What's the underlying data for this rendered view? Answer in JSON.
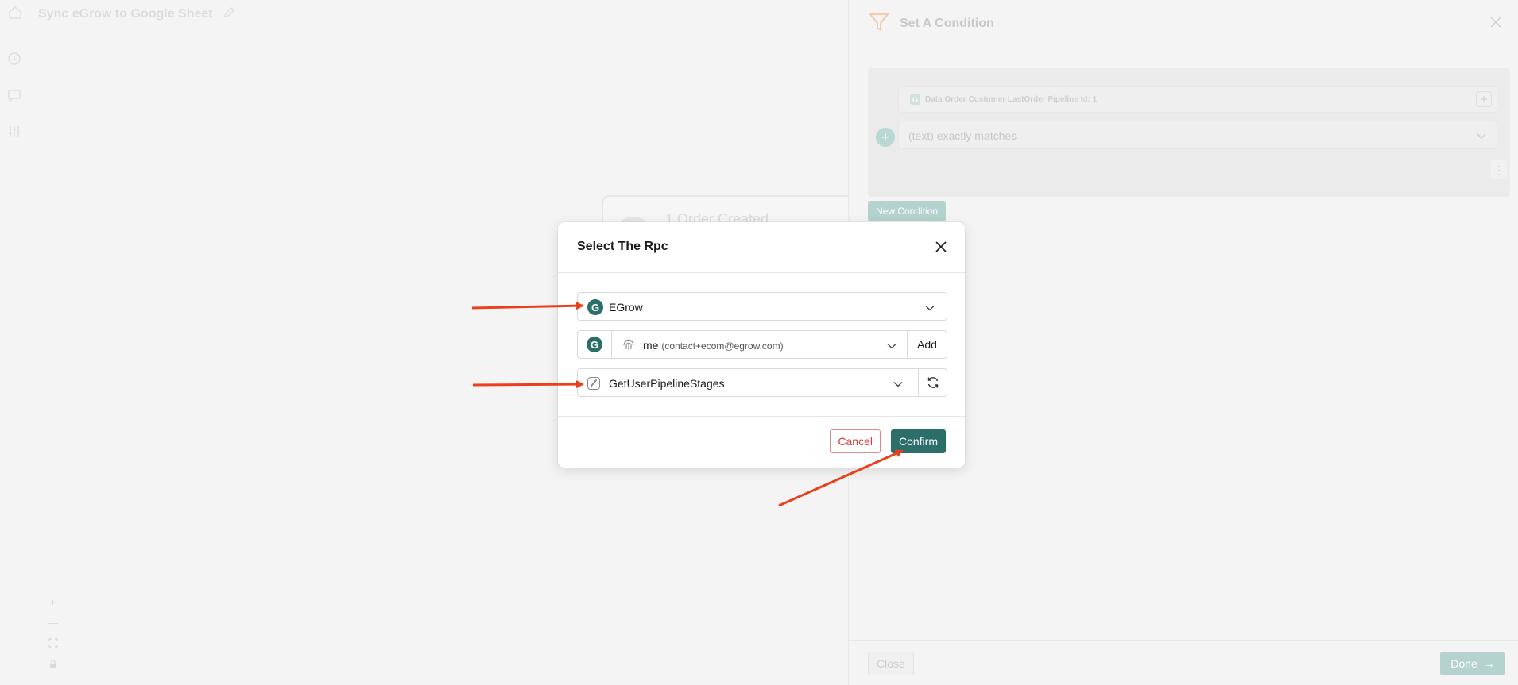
{
  "app": {
    "workflow_title": "Sync eGrow to Google Sheet"
  },
  "canvas": {
    "node_title": "1 Order Created",
    "zoom_in": "+",
    "zoom_out": "—"
  },
  "condition_panel": {
    "title": "Set A Condition",
    "field_chip_icon": "G",
    "field_chip_label": "Data Order Customer LastOrder Pipeline Id: 1",
    "field_plus": "+",
    "add_symbol": "+",
    "operator": "(text) exactly matches",
    "more_symbol": "⋮",
    "new_condition_label": "New Condition",
    "close_label": "Close",
    "done_label": "Done",
    "done_arrow": "→"
  },
  "modal": {
    "title": "Select The Rpc",
    "app_select": {
      "logo_letter": "G",
      "value": "EGrow"
    },
    "account": {
      "logo_letter": "G",
      "name": "me",
      "email": "(contact+ecom@egrow.com)",
      "add_label": "Add"
    },
    "rpc_select": {
      "value": "GetUserPipelineStages"
    },
    "cancel_label": "Cancel",
    "confirm_label": "Confirm"
  },
  "colors": {
    "brand_teal": "#2b6e6a",
    "cancel_red": "#d63c3c",
    "annotation_arrow": "#e8401c"
  },
  "icons": {
    "header": "home-icon",
    "edit": "pencil-icon",
    "rail": [
      "history-icon",
      "chat-icon",
      "sliders-icon"
    ],
    "panel": "filter-icon",
    "close": "close-icon",
    "refresh": "refresh-icon",
    "account": "fingerprint-icon"
  }
}
